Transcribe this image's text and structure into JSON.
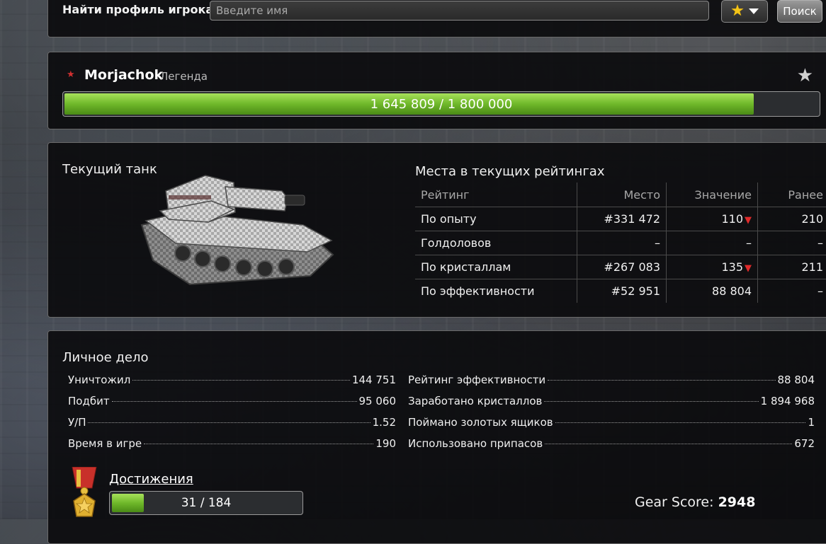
{
  "search": {
    "label": "Найти профиль игрока",
    "placeholder": "Введите имя",
    "button_label": "Поиск"
  },
  "profile": {
    "name": "Morjachok",
    "rank": "Легенда",
    "xp_text": "1 645 809 / 1 800 000",
    "xp_current": 1645809,
    "xp_max": 1800000
  },
  "tank": {
    "title": "Текущий танк"
  },
  "ratings": {
    "title": "Места в текущих рейтингах",
    "headers": [
      "Рейтинг",
      "Место",
      "Значение",
      "Ранее"
    ],
    "rows": [
      {
        "name": "По опыту",
        "place": "#331 472",
        "value": "110",
        "trend": "down",
        "previous": "210"
      },
      {
        "name": "Голдоловов",
        "place": "–",
        "value": "–",
        "trend": "",
        "previous": "–"
      },
      {
        "name": "По кристаллам",
        "place": "#267 083",
        "value": "135",
        "trend": "down",
        "previous": "211"
      },
      {
        "name": "По эффективности",
        "place": "#52 951",
        "value": "88 804",
        "trend": "",
        "previous": "–"
      }
    ]
  },
  "dossier": {
    "title": "Личное дело",
    "left": [
      {
        "label": "Уничтожил",
        "value": "144 751"
      },
      {
        "label": "Подбит",
        "value": "95 060"
      },
      {
        "label": "У/П",
        "value": "1.52"
      },
      {
        "label": "Время в игре",
        "value": "190"
      }
    ],
    "right": [
      {
        "label": "Рейтинг эффективности",
        "value": "88 804"
      },
      {
        "label": "Заработано кристаллов",
        "value": "1 894 968"
      },
      {
        "label": "Поймано золотых ящиков",
        "value": "1"
      },
      {
        "label": "Использовано припасов",
        "value": "672"
      }
    ]
  },
  "achievements": {
    "label": "Достижения",
    "progress_text": "31 / 184",
    "current": 31,
    "total": 184
  },
  "gear_score": {
    "label": "Gear Score:",
    "value": "2948"
  },
  "colors": {
    "progress_green": "#6fb82a",
    "trend_down": "#e02a2a",
    "favorite_star": "#f5c518"
  }
}
